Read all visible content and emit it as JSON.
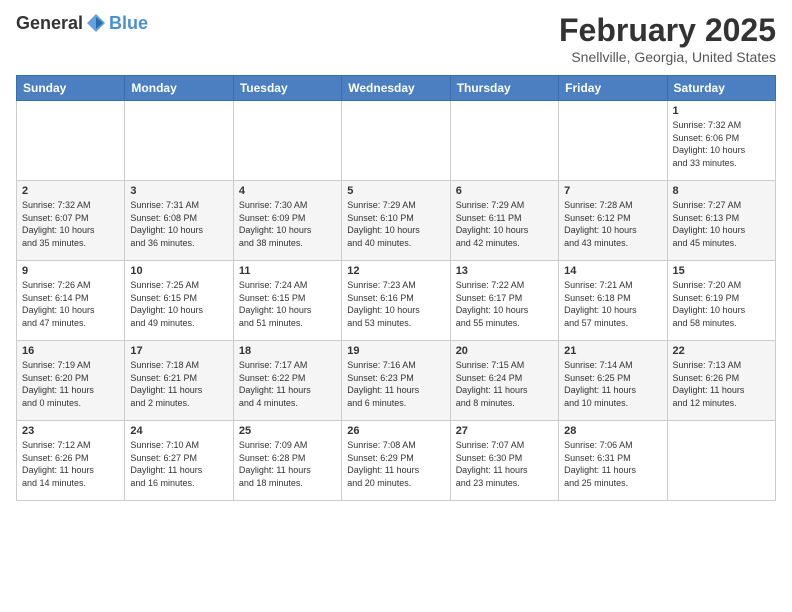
{
  "header": {
    "logo_general": "General",
    "logo_blue": "Blue",
    "month_title": "February 2025",
    "location": "Snellville, Georgia, United States"
  },
  "weekdays": [
    "Sunday",
    "Monday",
    "Tuesday",
    "Wednesday",
    "Thursday",
    "Friday",
    "Saturday"
  ],
  "weeks": [
    [
      {
        "day": "",
        "info": ""
      },
      {
        "day": "",
        "info": ""
      },
      {
        "day": "",
        "info": ""
      },
      {
        "day": "",
        "info": ""
      },
      {
        "day": "",
        "info": ""
      },
      {
        "day": "",
        "info": ""
      },
      {
        "day": "1",
        "info": "Sunrise: 7:32 AM\nSunset: 6:06 PM\nDaylight: 10 hours\nand 33 minutes."
      }
    ],
    [
      {
        "day": "2",
        "info": "Sunrise: 7:32 AM\nSunset: 6:07 PM\nDaylight: 10 hours\nand 35 minutes."
      },
      {
        "day": "3",
        "info": "Sunrise: 7:31 AM\nSunset: 6:08 PM\nDaylight: 10 hours\nand 36 minutes."
      },
      {
        "day": "4",
        "info": "Sunrise: 7:30 AM\nSunset: 6:09 PM\nDaylight: 10 hours\nand 38 minutes."
      },
      {
        "day": "5",
        "info": "Sunrise: 7:29 AM\nSunset: 6:10 PM\nDaylight: 10 hours\nand 40 minutes."
      },
      {
        "day": "6",
        "info": "Sunrise: 7:29 AM\nSunset: 6:11 PM\nDaylight: 10 hours\nand 42 minutes."
      },
      {
        "day": "7",
        "info": "Sunrise: 7:28 AM\nSunset: 6:12 PM\nDaylight: 10 hours\nand 43 minutes."
      },
      {
        "day": "8",
        "info": "Sunrise: 7:27 AM\nSunset: 6:13 PM\nDaylight: 10 hours\nand 45 minutes."
      }
    ],
    [
      {
        "day": "9",
        "info": "Sunrise: 7:26 AM\nSunset: 6:14 PM\nDaylight: 10 hours\nand 47 minutes."
      },
      {
        "day": "10",
        "info": "Sunrise: 7:25 AM\nSunset: 6:15 PM\nDaylight: 10 hours\nand 49 minutes."
      },
      {
        "day": "11",
        "info": "Sunrise: 7:24 AM\nSunset: 6:15 PM\nDaylight: 10 hours\nand 51 minutes."
      },
      {
        "day": "12",
        "info": "Sunrise: 7:23 AM\nSunset: 6:16 PM\nDaylight: 10 hours\nand 53 minutes."
      },
      {
        "day": "13",
        "info": "Sunrise: 7:22 AM\nSunset: 6:17 PM\nDaylight: 10 hours\nand 55 minutes."
      },
      {
        "day": "14",
        "info": "Sunrise: 7:21 AM\nSunset: 6:18 PM\nDaylight: 10 hours\nand 57 minutes."
      },
      {
        "day": "15",
        "info": "Sunrise: 7:20 AM\nSunset: 6:19 PM\nDaylight: 10 hours\nand 58 minutes."
      }
    ],
    [
      {
        "day": "16",
        "info": "Sunrise: 7:19 AM\nSunset: 6:20 PM\nDaylight: 11 hours\nand 0 minutes."
      },
      {
        "day": "17",
        "info": "Sunrise: 7:18 AM\nSunset: 6:21 PM\nDaylight: 11 hours\nand 2 minutes."
      },
      {
        "day": "18",
        "info": "Sunrise: 7:17 AM\nSunset: 6:22 PM\nDaylight: 11 hours\nand 4 minutes."
      },
      {
        "day": "19",
        "info": "Sunrise: 7:16 AM\nSunset: 6:23 PM\nDaylight: 11 hours\nand 6 minutes."
      },
      {
        "day": "20",
        "info": "Sunrise: 7:15 AM\nSunset: 6:24 PM\nDaylight: 11 hours\nand 8 minutes."
      },
      {
        "day": "21",
        "info": "Sunrise: 7:14 AM\nSunset: 6:25 PM\nDaylight: 11 hours\nand 10 minutes."
      },
      {
        "day": "22",
        "info": "Sunrise: 7:13 AM\nSunset: 6:26 PM\nDaylight: 11 hours\nand 12 minutes."
      }
    ],
    [
      {
        "day": "23",
        "info": "Sunrise: 7:12 AM\nSunset: 6:26 PM\nDaylight: 11 hours\nand 14 minutes."
      },
      {
        "day": "24",
        "info": "Sunrise: 7:10 AM\nSunset: 6:27 PM\nDaylight: 11 hours\nand 16 minutes."
      },
      {
        "day": "25",
        "info": "Sunrise: 7:09 AM\nSunset: 6:28 PM\nDaylight: 11 hours\nand 18 minutes."
      },
      {
        "day": "26",
        "info": "Sunrise: 7:08 AM\nSunset: 6:29 PM\nDaylight: 11 hours\nand 20 minutes."
      },
      {
        "day": "27",
        "info": "Sunrise: 7:07 AM\nSunset: 6:30 PM\nDaylight: 11 hours\nand 23 minutes."
      },
      {
        "day": "28",
        "info": "Sunrise: 7:06 AM\nSunset: 6:31 PM\nDaylight: 11 hours\nand 25 minutes."
      },
      {
        "day": "",
        "info": ""
      }
    ]
  ]
}
